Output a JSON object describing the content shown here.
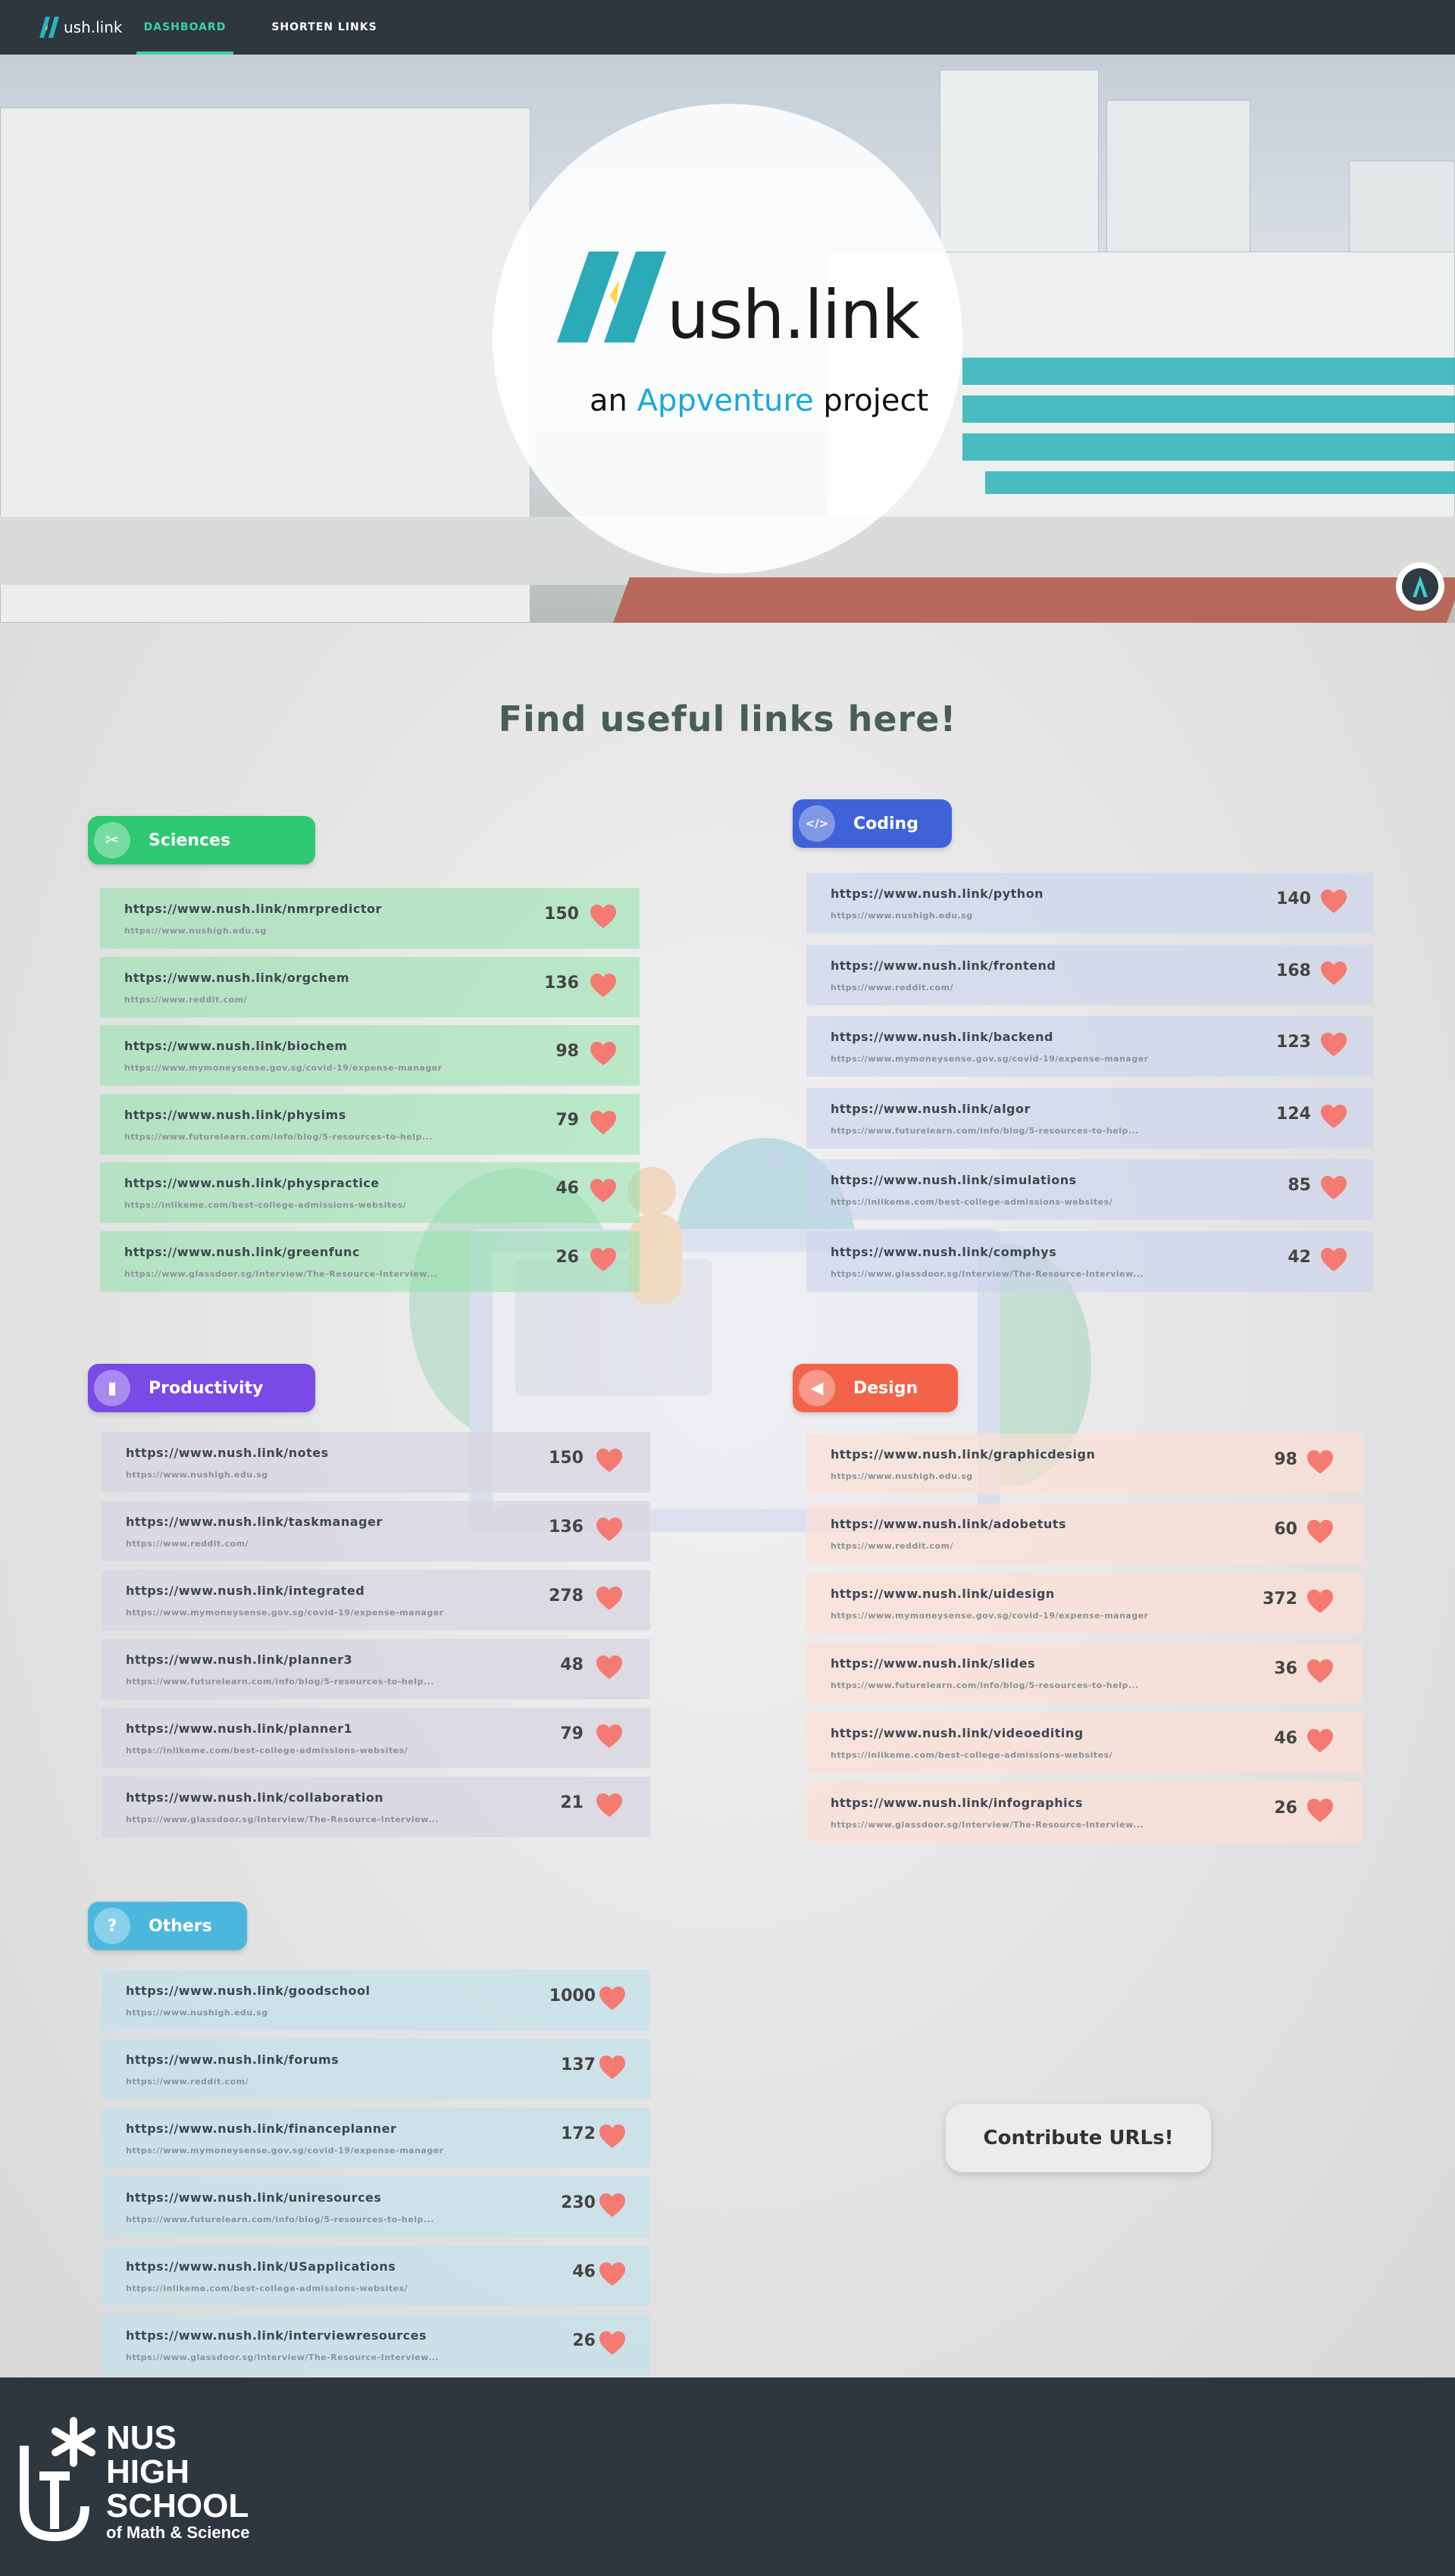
{
  "nav": {
    "brand": "ush.link",
    "links": [
      "DASHBOARD",
      "SHORTEN LINKS"
    ]
  },
  "hero": {
    "logo_text": "ush.link",
    "sub_prefix": "an",
    "sub_accent": "Appventure",
    "sub_suffix": "project"
  },
  "main": {
    "title": "Find useful links here!",
    "contribute_label": "Contribute URLs!"
  },
  "categories": [
    {
      "name": "Sciences",
      "color": "#2ec872",
      "row_color": "rgba(137,226,166,0.5)",
      "icon": "ruler-icon",
      "glyph": "✂",
      "links": [
        {
          "url": "https://www.nush.link/nmrpredictor",
          "src": "https://www.nushigh.edu.sg",
          "likes": "150"
        },
        {
          "url": "https://www.nush.link/orgchem",
          "src": "https://www.reddit.com/",
          "likes": "136"
        },
        {
          "url": "https://www.nush.link/biochem",
          "src": "https://www.mymoneysense.gov.sg/covid-19/expense-manager",
          "likes": "98"
        },
        {
          "url": "https://www.nush.link/physims",
          "src": "https://www.futurelearn.com/info/blog/5-resources-to-help...",
          "likes": "79"
        },
        {
          "url": "https://www.nush.link/physpractice",
          "src": "https://inlikeme.com/best-college-admissions-websites/",
          "likes": "46"
        },
        {
          "url": "https://www.nush.link/greenfunc",
          "src": "https://www.glassdoor.sg/Interview/The-Resource-Interview...",
          "likes": "26"
        }
      ]
    },
    {
      "name": "Coding",
      "color": "#3e63d8",
      "row_color": "rgba(202,212,236,0.6)",
      "icon": "code-icon",
      "glyph": "</>",
      "links": [
        {
          "url": "https://www.nush.link/python",
          "src": "https://www.nushigh.edu.sg",
          "likes": "140"
        },
        {
          "url": "https://www.nush.link/frontend",
          "src": "https://www.reddit.com/",
          "likes": "168"
        },
        {
          "url": "https://www.nush.link/backend",
          "src": "https://www.mymoneysense.gov.sg/covid-19/expense-manager",
          "likes": "123"
        },
        {
          "url": "https://www.nush.link/algor",
          "src": "https://www.futurelearn.com/info/blog/5-resources-to-help...",
          "likes": "124"
        },
        {
          "url": "https://www.nush.link/simulations",
          "src": "https://inlikeme.com/best-college-admissions-websites/",
          "likes": "85"
        },
        {
          "url": "https://www.nush.link/comphys",
          "src": "https://www.glassdoor.sg/Interview/The-Resource-Interview...",
          "likes": "42"
        }
      ]
    },
    {
      "name": "Productivity",
      "color": "#7a4ae6",
      "row_color": "rgba(216,214,224,0.8)",
      "icon": "notebook-icon",
      "glyph": "▮",
      "links": [
        {
          "url": "https://www.nush.link/notes",
          "src": "https://www.nushigh.edu.sg",
          "likes": "150"
        },
        {
          "url": "https://www.nush.link/taskmanager",
          "src": "https://www.reddit.com/",
          "likes": "136"
        },
        {
          "url": "https://www.nush.link/integrated",
          "src": "https://www.mymoneysense.gov.sg/covid-19/expense-manager",
          "likes": "278"
        },
        {
          "url": "https://www.nush.link/planner3",
          "src": "https://www.futurelearn.com/info/blog/5-resources-to-help...",
          "likes": "48"
        },
        {
          "url": "https://www.nush.link/planner1",
          "src": "https://inlikeme.com/best-college-admissions-websites/",
          "likes": "79"
        },
        {
          "url": "https://www.nush.link/collaboration",
          "src": "https://www.glassdoor.sg/Interview/The-Resource-Interview...",
          "likes": "21"
        }
      ]
    },
    {
      "name": "Design",
      "color": "#f2634a",
      "row_color": "rgba(253,222,210,0.65)",
      "icon": "megaphone-icon",
      "glyph": "◀",
      "links": [
        {
          "url": "https://www.nush.link/graphicdesign",
          "src": "https://www.nushigh.edu.sg",
          "likes": "98"
        },
        {
          "url": "https://www.nush.link/adobetuts",
          "src": "https://www.reddit.com/",
          "likes": "60"
        },
        {
          "url": "https://www.nush.link/uidesign",
          "src": "https://www.mymoneysense.gov.sg/covid-19/expense-manager",
          "likes": "372"
        },
        {
          "url": "https://www.nush.link/slides",
          "src": "https://www.futurelearn.com/info/blog/5-resources-to-help...",
          "likes": "36"
        },
        {
          "url": "https://www.nush.link/videoediting",
          "src": "https://inlikeme.com/best-college-admissions-websites/",
          "likes": "46"
        },
        {
          "url": "https://www.nush.link/infographics",
          "src": "https://www.glassdoor.sg/Interview/The-Resource-Interview...",
          "likes": "26"
        }
      ]
    },
    {
      "name": "Others",
      "color": "#4cb7dd",
      "row_color": "rgba(198,226,234,0.75)",
      "icon": "question-icon",
      "glyph": "?",
      "links": [
        {
          "url": "https://www.nush.link/goodschool",
          "src": "https://www.nushigh.edu.sg",
          "likes": "1000"
        },
        {
          "url": "https://www.nush.link/forums",
          "src": "https://www.reddit.com/",
          "likes": "137"
        },
        {
          "url": "https://www.nush.link/financeplanner",
          "src": "https://www.mymoneysense.gov.sg/covid-19/expense-manager",
          "likes": "172"
        },
        {
          "url": "https://www.nush.link/uniresources",
          "src": "https://www.futurelearn.com/info/blog/5-resources-to-help...",
          "likes": "230"
        },
        {
          "url": "https://www.nush.link/USapplications",
          "src": "https://inlikeme.com/best-college-admissions-websites/",
          "likes": "46"
        },
        {
          "url": "https://www.nush.link/interviewresources",
          "src": "https://www.glassdoor.sg/Interview/The-Resource-Interview...",
          "likes": "26"
        }
      ]
    }
  ],
  "footer": {
    "lines": [
      "NUS",
      "HIGH",
      "SCHOOL"
    ],
    "sub": "of Math & Science"
  },
  "colors": {
    "nav_bg": "#2e363e",
    "nav_active": "#3ecfa8",
    "heart": "#f47a72",
    "title": "#485e56"
  }
}
